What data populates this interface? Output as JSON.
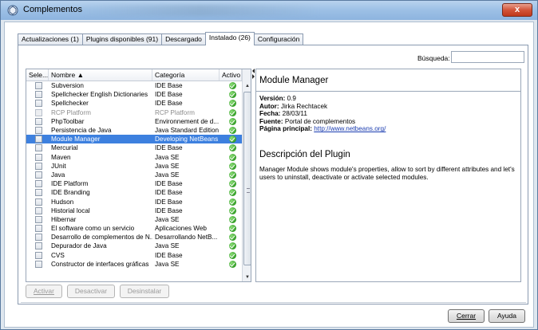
{
  "window": {
    "title": "Complementos",
    "close_label": "x"
  },
  "tabs": [
    {
      "label": "Actualizaciones (1)",
      "active": false
    },
    {
      "label": "Plugins disponibles (91)",
      "active": false
    },
    {
      "label": "Descargado",
      "active": false
    },
    {
      "label": "Instalado (26)",
      "active": true
    },
    {
      "label": "Configuración",
      "active": false
    }
  ],
  "search": {
    "label": "Búsqueda:",
    "value": ""
  },
  "table": {
    "columns": [
      "Sele...",
      "Nombre ▲",
      "Categoría",
      "Activo"
    ],
    "rows": [
      {
        "name": "Subversion",
        "category": "IDE Base",
        "state": "normal"
      },
      {
        "name": "Spellchecker English Dictionaries",
        "category": "IDE Base",
        "state": "normal"
      },
      {
        "name": "Spellchecker",
        "category": "IDE Base",
        "state": "normal"
      },
      {
        "name": "RCP Platform",
        "category": "RCP Platform",
        "state": "disabled"
      },
      {
        "name": "PhpToolbar",
        "category": "Environnement de d...",
        "state": "normal"
      },
      {
        "name": "Persistencia de Java",
        "category": "Java Standard Edition",
        "state": "normal"
      },
      {
        "name": "Module Manager",
        "category": "Developing NetBeans",
        "state": "selected"
      },
      {
        "name": "Mercurial",
        "category": "IDE Base",
        "state": "normal"
      },
      {
        "name": "Maven",
        "category": "Java SE",
        "state": "normal"
      },
      {
        "name": "JUnit",
        "category": "Java SE",
        "state": "normal"
      },
      {
        "name": "Java",
        "category": "Java SE",
        "state": "normal"
      },
      {
        "name": "IDE Platform",
        "category": "IDE Base",
        "state": "normal"
      },
      {
        "name": "IDE Branding",
        "category": "IDE Base",
        "state": "normal"
      },
      {
        "name": "Hudson",
        "category": "IDE Base",
        "state": "normal"
      },
      {
        "name": "Historial local",
        "category": "IDE Base",
        "state": "normal"
      },
      {
        "name": "Hibernar",
        "category": "Java SE",
        "state": "normal"
      },
      {
        "name": "El software como un servicio",
        "category": "Aplicaciones Web",
        "state": "normal"
      },
      {
        "name": "Desarrollo de complementos de N...",
        "category": "Desarrollando NetB...",
        "state": "normal"
      },
      {
        "name": "Depurador de Java",
        "category": "Java SE",
        "state": "normal"
      },
      {
        "name": "CVS",
        "category": "IDE Base",
        "state": "normal"
      },
      {
        "name": "Constructor de interfaces gráficas",
        "category": "Java SE",
        "state": "normal"
      }
    ]
  },
  "details": {
    "title": "Module Manager",
    "version_label": "Versión:",
    "version": "0.9",
    "author_label": "Autor:",
    "author": "Jirka Rechtacek",
    "date_label": "Fecha:",
    "date": "28/03/11",
    "source_label": "Fuente:",
    "source": "Portal de complementos",
    "homepage_label": "Página principal:",
    "homepage": "http://www.netbeans.org/",
    "desc_title": "Descripción del Plugin",
    "description": "Manager Module shows module's properties, allow to sort by different attributes and let's users to uninstall, deactivate or activate selected modules."
  },
  "actions": {
    "activate": "Activar",
    "deactivate": "Desactivar",
    "uninstall": "Desinstalar",
    "close": "Cerrar",
    "help": "Ayuda"
  },
  "colors": {
    "selection": "#3d80df",
    "link": "#1a3cb0",
    "titlebar": "#9ec1e6"
  }
}
